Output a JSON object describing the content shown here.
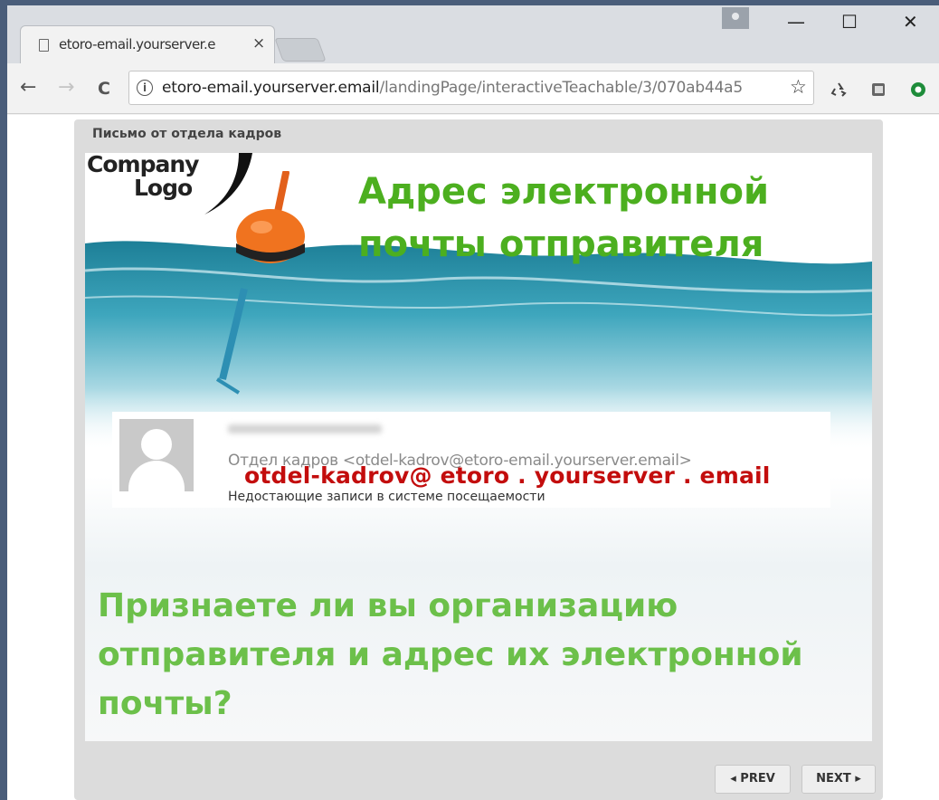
{
  "browser": {
    "tab_title": "etoro-email.yourserver.e",
    "tab_close": "×",
    "url_host": "etoro-email.yourserver.email",
    "url_path": "/landingPage/interactiveTeachable/3/070ab44a5",
    "window_controls": {
      "minimize": "—",
      "maximize": "☐",
      "close": "✕"
    },
    "nav": {
      "back": "←",
      "forward": "→",
      "reload": "C"
    },
    "star": "☆",
    "icons": [
      "info-icon",
      "star-icon",
      "recycle-extension-icon",
      "square-extension-icon",
      "green-circle-extension-icon"
    ]
  },
  "player": {
    "title": "Письмо от отдела кадров",
    "prev_label": "◂ PREV",
    "next_label": "NEXT ▸"
  },
  "slide": {
    "logo_line1": "Company",
    "logo_line2": "Logo",
    "headline_line1": "Адрес электронной",
    "headline_line2": "почты отправителя",
    "email_card": {
      "sender_text": "Отдел кадров <otdel-kadrov@etoro-email.yourserver.email>",
      "overlay_text": "otdel-kadrov@ etoro . yourserver . email",
      "subject": "Недостающие записи в системе посещаемости"
    },
    "question": "Признаете ли вы организацию отправителя и адрес их электронной почты?",
    "colors": {
      "headline": "#4caf1f",
      "question": "#6cc04a",
      "overlay": "#c30d0d"
    }
  }
}
